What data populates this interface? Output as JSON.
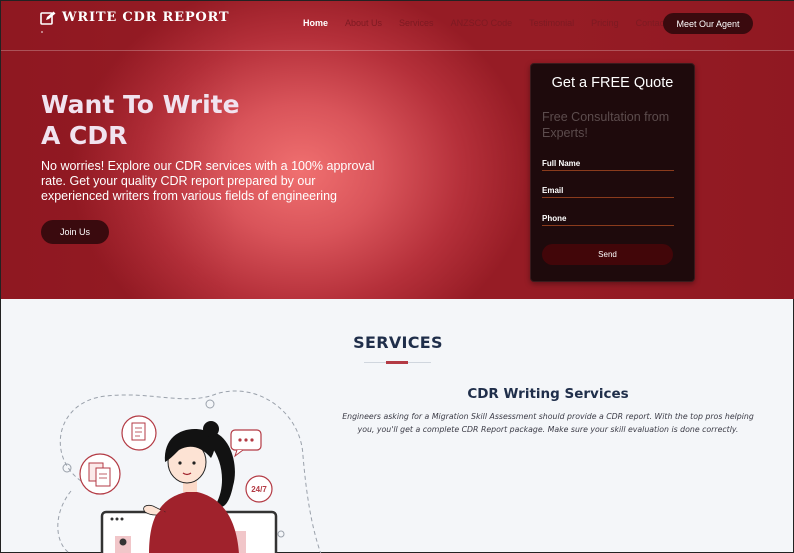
{
  "brand": {
    "name": "WRITE CDR REPORT",
    "icon": "edit-icon"
  },
  "nav": {
    "items": [
      {
        "label": "Home",
        "active": true
      },
      {
        "label": "About Us"
      },
      {
        "label": "Services"
      },
      {
        "label": "ANZSCO Code"
      },
      {
        "label": "Testimonial"
      },
      {
        "label": "Pricing"
      },
      {
        "label": "Contact"
      }
    ],
    "cta": "Meet Our Agent"
  },
  "hero": {
    "title_line1": "Want To Write",
    "title_line2": "A CDR",
    "description": "No worries! Explore our CDR services with a 100% approval rate. Get your quality CDR report prepared by our experienced writers from various fields of engineering",
    "button": "Join Us"
  },
  "quote_form": {
    "title": "Get a FREE Quote",
    "subtitle": "Free Consultation from Experts!",
    "fields": {
      "full_name": {
        "placeholder": "Full Name",
        "value": ""
      },
      "email": {
        "placeholder": "Email",
        "value": ""
      },
      "phone": {
        "placeholder": "Phone",
        "value": ""
      }
    },
    "submit": "Send"
  },
  "services": {
    "heading": "SERVICES",
    "item": {
      "title": "CDR Writing Services",
      "description": "Engineers asking for a Migration Skill Assessment should provide a CDR report. With the top pros helping you, you'll get a complete CDR Report package. Make sure your skill evaluation is done correctly."
    },
    "illustration_badge": "24/7"
  },
  "colors": {
    "hero_center": "#f07070",
    "hero_edge": "#961c25",
    "dark_maroon": "#3a0a0e",
    "heading_navy": "#1f2e4a",
    "accent": "#b33a44"
  }
}
